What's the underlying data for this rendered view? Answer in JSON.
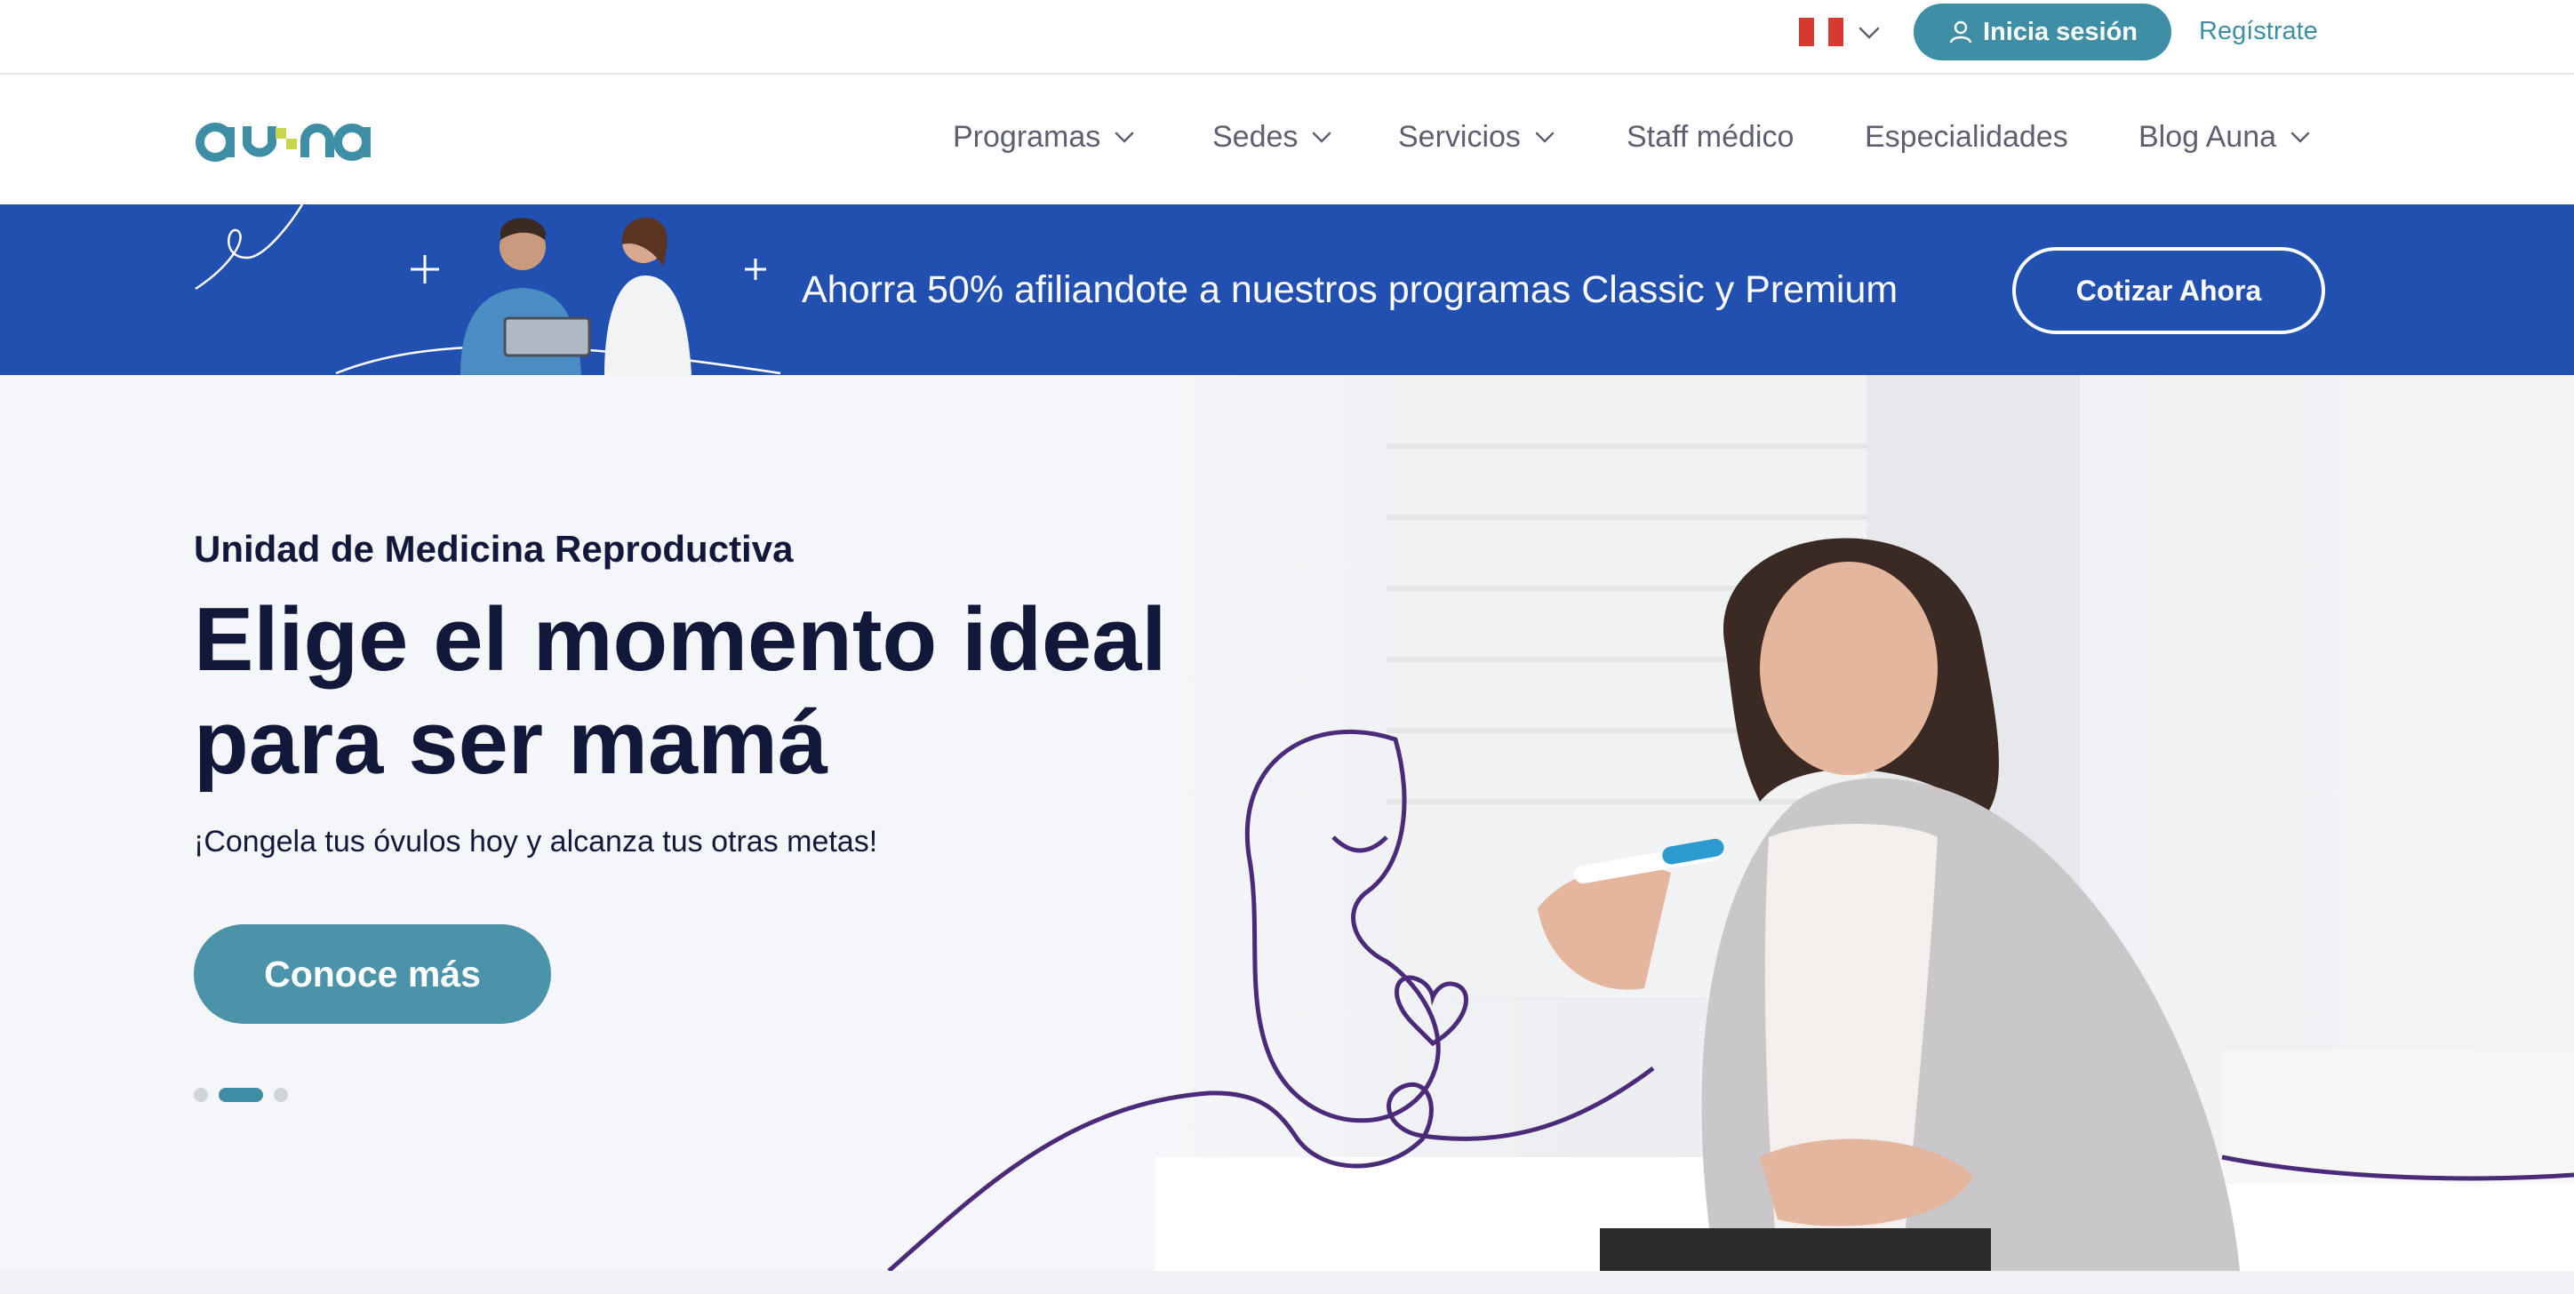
{
  "topbar": {
    "country_flag": "peru-flag-icon",
    "login_label": "Inicia sesión",
    "register_label": "Regístrate"
  },
  "brand": {
    "logo_text": "auna",
    "colors": {
      "primary": "#3e8fa6",
      "accent": "#c6d84a",
      "promo_bg": "#2250b0",
      "ink": "#12183a"
    }
  },
  "nav": {
    "items": [
      {
        "label": "Programas",
        "has_dropdown": true
      },
      {
        "label": "Sedes",
        "has_dropdown": true
      },
      {
        "label": "Servicios",
        "has_dropdown": true
      },
      {
        "label": "Staff médico",
        "has_dropdown": false
      },
      {
        "label": "Especialidades",
        "has_dropdown": false
      },
      {
        "label": "Blog Auna",
        "has_dropdown": true
      }
    ]
  },
  "promo": {
    "text": "Ahorra 50% afiliandote a nuestros programas Classic y Premium",
    "button_label": "Cotizar Ahora"
  },
  "hero": {
    "eyebrow": "Unidad de Medicina Reproductiva",
    "headline_line1": "Elige el momento ideal",
    "headline_line2": "para ser mamá",
    "subline": "¡Congela tus óvulos hoy y alcanza tus otras metas!",
    "cta_label": "Conoce más",
    "carousel": {
      "slides": 3,
      "active_index": 1
    }
  }
}
